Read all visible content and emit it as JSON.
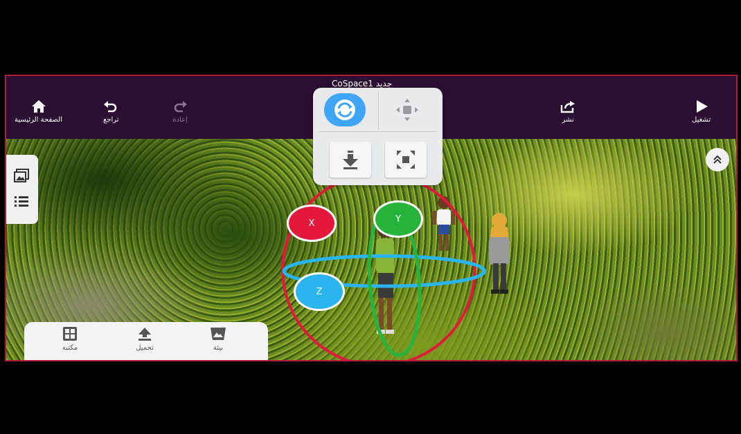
{
  "project_title": "CoSpace1 جديد",
  "toolbar": {
    "home_label": "الصفحة الرئيسية",
    "undo_label": "تراجع",
    "redo_label": "إعادة",
    "share_label": "نشر",
    "play_label": "تشغيل"
  },
  "transform_modes": {
    "rotate_icon": "rotate-icon",
    "move_icon": "move-icon",
    "drop_icon": "drop-to-ground-icon",
    "scale_icon": "scale-icon",
    "selected": "rotate"
  },
  "side_panel": {
    "icons": [
      "image-gallery-icon",
      "list-icon"
    ]
  },
  "bottom_toolbar": {
    "library_label": "مكتبة",
    "upload_label": "تحميل",
    "environment_label": "بيئة"
  },
  "gizmo": {
    "x_label": "X",
    "y_label": "Y",
    "z_label": "Z"
  },
  "colors": {
    "topbar": "#2a0f33",
    "accent_blue": "#3ea6f5",
    "axis_x": "#e3183a",
    "axis_y": "#27b43c",
    "axis_z": "#2bb5ef"
  }
}
